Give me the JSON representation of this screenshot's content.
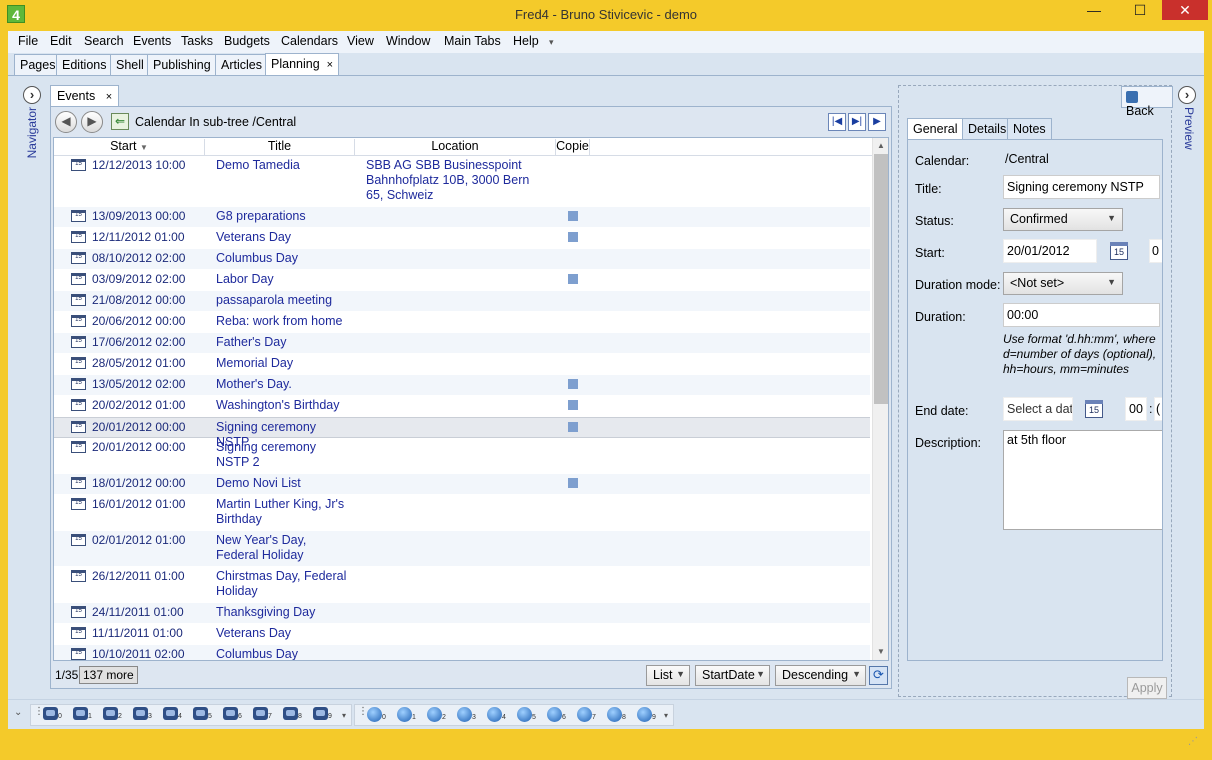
{
  "window": {
    "app_icon_label": "4",
    "title": "Fred4 - Bruno Stivicevic - demo",
    "minimize": "—",
    "maximize": "☐",
    "close": "✕"
  },
  "menu": {
    "items": [
      "File",
      "Edit",
      "Search",
      "Events",
      "Tasks",
      "Budgets",
      "Calendars",
      "View",
      "Window",
      "Main Tabs",
      "Help"
    ],
    "overflow": "▾"
  },
  "main_tabs": [
    {
      "label": "Pages"
    },
    {
      "label": "Editions"
    },
    {
      "label": "Shell"
    },
    {
      "label": "Publishing"
    },
    {
      "label": "Articles"
    },
    {
      "label": "Planning",
      "active": true,
      "close": "×"
    }
  ],
  "rails": {
    "navigator_label": "Navigator",
    "navigator_toggle": "›",
    "preview_label": "Preview",
    "preview_toggle": "›"
  },
  "events": {
    "tab_label": "Events",
    "tab_close": "×",
    "breadcrumb": "Calendar In sub-tree /Central",
    "nav_back": "◀",
    "nav_forward": "▶",
    "up_icon": "⇐",
    "pager": {
      "first": "|◀",
      "last": "▶|",
      "next": "▶"
    },
    "columns": {
      "start": "Start",
      "title": "Title",
      "location": "Location",
      "copies": "Copie",
      "sort_indicator": "▼"
    },
    "rows": [
      {
        "start": "12/12/2013 10:00",
        "title": "Demo Tamedia",
        "location": "SBB AG SBB Businesspoint Bahnhofplatz 10B, 3000 Bern 65, Schweiz",
        "copy": false
      },
      {
        "start": "13/09/2013 00:00",
        "title": "G8 preparations",
        "location": "",
        "copy": true
      },
      {
        "start": "12/11/2012 01:00",
        "title": "Veterans Day",
        "location": "",
        "copy": true
      },
      {
        "start": "08/10/2012 02:00",
        "title": "Columbus Day",
        "location": "",
        "copy": false
      },
      {
        "start": "03/09/2012 02:00",
        "title": "Labor Day",
        "location": "",
        "copy": true
      },
      {
        "start": "21/08/2012 00:00",
        "title": "passaparola meeting",
        "location": "",
        "copy": false
      },
      {
        "start": "20/06/2012 00:00",
        "title": "Reba: work from home",
        "location": "",
        "copy": false
      },
      {
        "start": "17/06/2012 02:00",
        "title": "Father's Day",
        "location": "",
        "copy": false
      },
      {
        "start": "28/05/2012 01:00",
        "title": "Memorial Day",
        "location": "",
        "copy": false
      },
      {
        "start": "13/05/2012 02:00",
        "title": "Mother's Day.",
        "location": "",
        "copy": true
      },
      {
        "start": "20/02/2012 01:00",
        "title": "Washington's Birthday",
        "location": "",
        "copy": true
      },
      {
        "start": "20/01/2012 00:00",
        "title": "Signing ceremony NSTP",
        "location": "",
        "copy": true,
        "selected": true
      },
      {
        "start": "20/01/2012 00:00",
        "title": "Signing ceremony NSTP 2",
        "location": "",
        "copy": false
      },
      {
        "start": "18/01/2012 00:00",
        "title": "Demo Novi List",
        "location": "",
        "copy": true
      },
      {
        "start": "16/01/2012 01:00",
        "title": "Martin Luther King, Jr's Birthday",
        "location": "",
        "copy": false
      },
      {
        "start": "02/01/2012 01:00",
        "title": "New Year's Day, Federal Holiday",
        "location": "",
        "copy": false
      },
      {
        "start": "26/12/2011 01:00",
        "title": "Chirstmas Day, Federal Holiday",
        "location": "",
        "copy": false
      },
      {
        "start": "24/11/2011 01:00",
        "title": "Thanksgiving Day",
        "location": "",
        "copy": false
      },
      {
        "start": "11/11/2011 01:00",
        "title": "Veterans Day",
        "location": "",
        "copy": false
      },
      {
        "start": "10/10/2011 02:00",
        "title": "Columbus Day",
        "location": "",
        "copy": false
      }
    ],
    "row_icon_text": "15",
    "footer": {
      "count": "1/35",
      "more": "137 more",
      "view_mode": "List",
      "sort_field": "StartDate",
      "sort_order": "Descending",
      "refresh_icon": "⟳"
    },
    "scroll": {
      "up": "▲",
      "down": "▼"
    }
  },
  "detail": {
    "back_label": "Back",
    "tabs": [
      {
        "label": "General",
        "active": true
      },
      {
        "label": "Details"
      },
      {
        "label": "Notes"
      }
    ],
    "calendar_label": "Calendar:",
    "calendar_value": "/Central",
    "title_label": "Title:",
    "title_value": "Signing ceremony NSTP",
    "status_label": "Status:",
    "status_value": "Confirmed",
    "start_label": "Start:",
    "start_date": "20/01/2012",
    "start_time": "0",
    "duration_mode_label": "Duration mode:",
    "duration_mode_value": "<Not set>",
    "duration_label": "Duration:",
    "duration_value": "00:00",
    "duration_hint": "Use format 'd.hh:mm', where d=number of days (optional), hh=hours, mm=minutes",
    "end_label": "End date:",
    "end_placeholder": "Select a date",
    "end_hour": "00",
    "end_sep": ":",
    "end_min": "(",
    "description_label": "Description:",
    "description_value": "at 5th floor",
    "date_icon_text": "15",
    "apply_label": "Apply"
  },
  "bottom_toolbar": {
    "group1": [
      "0",
      "1",
      "2",
      "3",
      "4",
      "5",
      "6",
      "7",
      "8",
      "9"
    ],
    "group2": [
      "0",
      "1",
      "2",
      "3",
      "4",
      "5",
      "6",
      "7",
      "8",
      "9"
    ],
    "chevron": "⌄",
    "grip": "⋮",
    "overflow": "▾"
  },
  "status": {
    "resize_grip": "⋰"
  }
}
